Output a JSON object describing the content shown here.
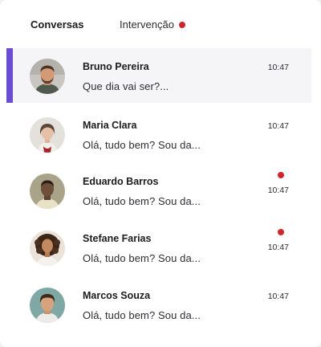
{
  "colors": {
    "accent": "#6a4dd2",
    "unread": "#d0262b",
    "selected_bg": "#f5f5f7"
  },
  "tabs": [
    {
      "label": "Conversas",
      "active": true
    },
    {
      "label": "Intervenção",
      "active": false,
      "has_notification": true
    }
  ],
  "conversations": [
    {
      "name": "Bruno Pereira",
      "preview": "Que dia vai ser?...",
      "time": "10:47",
      "unread": false,
      "selected": true,
      "avatar": "male-bearded-avatar"
    },
    {
      "name": "Maria Clara",
      "preview": "Olá, tudo bem? Sou da...",
      "time": "10:47",
      "unread": false,
      "selected": false,
      "avatar": "female-avatar"
    },
    {
      "name": "Eduardo Barros",
      "preview": "Olá, tudo bem? Sou da...",
      "time": "10:47",
      "unread": true,
      "selected": false,
      "avatar": "male-avatar"
    },
    {
      "name": "Stefane Farias",
      "preview": "Olá, tudo bem? Sou da...",
      "time": "10:47",
      "unread": true,
      "selected": false,
      "avatar": "female-curly-avatar"
    },
    {
      "name": "Marcos Souza",
      "preview": "Olá, tudo bem? Sou da...",
      "time": "10:47",
      "unread": false,
      "selected": false,
      "avatar": "male-young-avatar"
    }
  ]
}
